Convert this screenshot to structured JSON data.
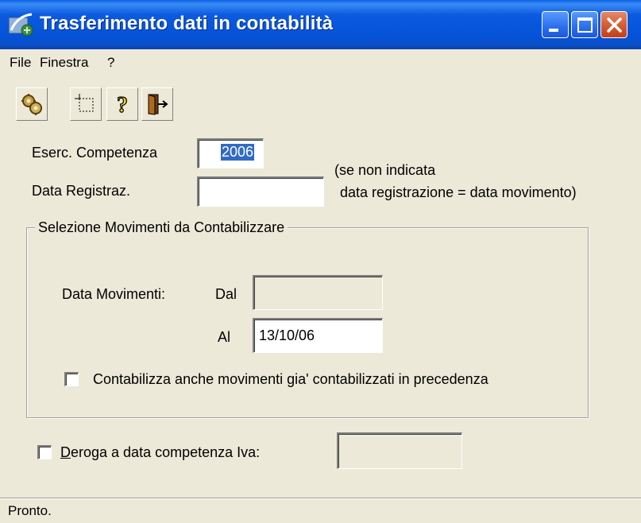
{
  "window": {
    "title": "Trasferimento dati in contabilità",
    "buttons": [
      "minimize",
      "maximize",
      "close"
    ]
  },
  "menu": {
    "items": [
      "File",
      "Finestra",
      "?"
    ]
  },
  "toolbar": {
    "icons": [
      "gears-icon",
      "select-frame-icon",
      "help-icon",
      "exit-door-icon"
    ]
  },
  "form": {
    "eserc_competenza": {
      "label": "Eserc. Competenza",
      "value": "2006"
    },
    "data_registraz": {
      "label": "Data Registraz.",
      "value": ""
    },
    "note_line1": "(se non indicata",
    "note_line2": "data registrazione = data movimento)",
    "group": {
      "title": "Selezione Movimenti da Contabilizzare",
      "data_movimenti_label": "Data Movimenti:",
      "dal_label": "Dal",
      "dal_value": "",
      "al_label": "Al",
      "al_value": "13/10/06",
      "chk_label": "Contabilizza anche movimenti gia' contabilizzati in precedenza",
      "chk_checked": false
    },
    "deroga": {
      "label_first": "D",
      "label_rest": "eroga a data competenza Iva:",
      "checked": false,
      "value": ""
    }
  },
  "status": {
    "text": "Pronto."
  },
  "colors": {
    "titlebar": "#0553d9",
    "face": "#ece9d8",
    "selection": "#316ac5"
  }
}
